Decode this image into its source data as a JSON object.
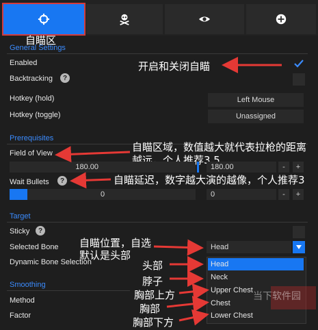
{
  "tabs": [
    {
      "icon": "crosshair-icon",
      "active": true
    },
    {
      "icon": "skull-icon",
      "active": false
    },
    {
      "icon": "eye-icon",
      "active": false
    },
    {
      "icon": "plus-icon",
      "active": false
    }
  ],
  "annotations": {
    "aim_area": "自瞄区",
    "enable_toggle": "开启和关闭自瞄",
    "fov_line1": "自瞄区域，数值越大就代表拉枪的距离",
    "fov_line2": "越远，个人推荐3.5",
    "wait_bullets": "自瞄延迟，数字越大演的越像，个人推荐3",
    "bone_line1": "自瞄位置，自选",
    "bone_line2": "默认是头部",
    "head": "头部",
    "neck": "脖子",
    "upper_chest": "胸部上方",
    "chest": "胸部",
    "lower_chest": "胸部下方"
  },
  "general": {
    "title": "General Settings",
    "enabled": "Enabled",
    "backtracking": "Backtracking",
    "hotkey_hold": "Hotkey (hold)",
    "hotkey_hold_value": "Left Mouse",
    "hotkey_toggle": "Hotkey (toggle)",
    "hotkey_toggle_value": "Unassigned"
  },
  "prerequisites": {
    "title": "Prerequisites",
    "fov": "Field of View",
    "fov_value_left": "180.00",
    "fov_value_right": "180.00",
    "wait_bullets": "Wait Bullets",
    "wait_left": "0",
    "wait_right": "0",
    "minus": "-",
    "plus": "+"
  },
  "target": {
    "title": "Target",
    "sticky": "Sticky",
    "selected_bone": "Selected Bone",
    "selected_bone_value": "Head",
    "dynamic_bone": "Dynamic Bone Selection",
    "bone_options": [
      "Head",
      "Neck",
      "Upper Chest",
      "Chest",
      "Lower Chest"
    ]
  },
  "smoothing": {
    "title": "Smoothing",
    "method": "Method",
    "factor": "Factor"
  },
  "watermark": "当下软件园",
  "colors": {
    "accent": "#1877f2",
    "arrow": "#e53935",
    "section": "#3b8cff"
  }
}
